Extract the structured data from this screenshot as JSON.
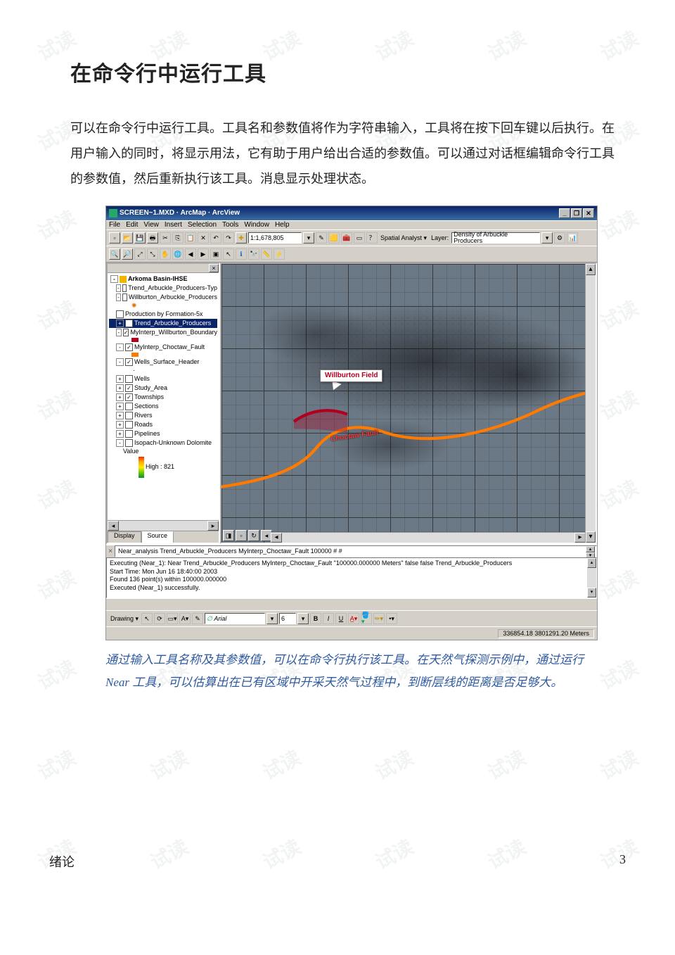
{
  "watermark": "试读",
  "heading": "在命令行中运行工具",
  "body": "可以在命令行中运行工具。工具名和参数值将作为字符串输入，工具将在按下回车键以后执行。在用户输入的同时，将显示用法，它有助于用户给出合适的参数值。可以通过对话框编辑命令行工具的参数值，然后重新执行该工具。消息显示处理状态。",
  "caption": "通过输入工具名称及其参数值，可以在命令行执行该工具。在天然气探测示例中，通过运行 Near 工具，可以估算出在已有区域中开采天然气过程中，到断层线的距离是否足够大。",
  "footer_left": "绪论",
  "footer_right": "3",
  "app": {
    "title": "SCREEN~1.MXD · ArcMap · ArcView",
    "window_buttons": {
      "min": "_",
      "max": "❐",
      "close": "✕"
    },
    "menubar": [
      "File",
      "Edit",
      "View",
      "Insert",
      "Selection",
      "Tools",
      "Window",
      "Help"
    ],
    "toolbar1": {
      "scale": "1:1,678,805",
      "spatial_analyst": "Spatial Analyst ▾",
      "layer_label": "Layer:",
      "layer_value": "Density of Arbuckle Producers"
    },
    "toc_header": "Arkoma Basin-IHSE",
    "toc": [
      {
        "ex": "-",
        "cb": "",
        "label": "Trend_Arbuckle_Producers-Typ"
      },
      {
        "ex": "-",
        "cb": "",
        "label": "Willburton_Arbuckle_Producers"
      },
      {
        "sym": "sun",
        "label": ""
      },
      {
        "cb": "",
        "label": "Production by Formation-5x"
      },
      {
        "ex": "+",
        "cb": "",
        "sel": true,
        "label": "Trend_Arbuckle_Producers"
      },
      {
        "ex": "-",
        "cb": "✓",
        "label": "MyInterp_Willburton_Boundary"
      },
      {
        "sw": "#b00020",
        "label": ""
      },
      {
        "ex": "-",
        "cb": "✓",
        "label": "MyInterp_Choctaw_Fault"
      },
      {
        "sw": "#ff7a00",
        "label": ""
      },
      {
        "ex": "-",
        "cb": "✓",
        "label": "Wells_Surface_Header"
      },
      {
        "dot": true,
        "label": ""
      },
      {
        "ex": "+",
        "cb": "",
        "label": "Wells"
      },
      {
        "ex": "+",
        "cb": "✓",
        "label": "Study_Area"
      },
      {
        "ex": "+",
        "cb": "✓",
        "label": "Townships"
      },
      {
        "ex": "+",
        "cb": "",
        "label": "Sections"
      },
      {
        "ex": "+",
        "cb": "",
        "label": "Rivers"
      },
      {
        "ex": "+",
        "cb": "",
        "label": "Roads"
      },
      {
        "ex": "+",
        "cb": "",
        "label": "Pipelines"
      },
      {
        "ex": "-",
        "cb": "",
        "label": "Isopach-Unknown Dolomite"
      },
      {
        "label": "Value",
        "lvl": 3
      },
      {
        "label": "High : 821",
        "lvl": 3,
        "ramp": true
      }
    ],
    "toc_tabs": {
      "display": "Display",
      "source": "Source"
    },
    "map": {
      "callout": "Willburton Field",
      "fault_label": "Choctaw Fault",
      "nav_icons": [
        "◨",
        "▫",
        "↻",
        "◂"
      ]
    },
    "cmd_line": "Near_analysis Trend_Arbuckle_Producers MyInterp_Choctaw_Fault 100000 # #",
    "log": [
      "Executing (Near_1): Near Trend_Arbuckle_Producers MyInterp_Choctaw_Fault \"100000.000000 Meters\" false false Trend_Arbuckle_Producers",
      "Start Time: Mon Jun 16 18:40:00 2003",
      "Found 136 point(s) within 100000.000000",
      "Executed (Near_1) successfully."
    ],
    "drawbar": {
      "label": "Drawing ▾",
      "font": "Arial",
      "size": "6"
    },
    "status_coords": "336854.18 3801291.20 Meters"
  }
}
